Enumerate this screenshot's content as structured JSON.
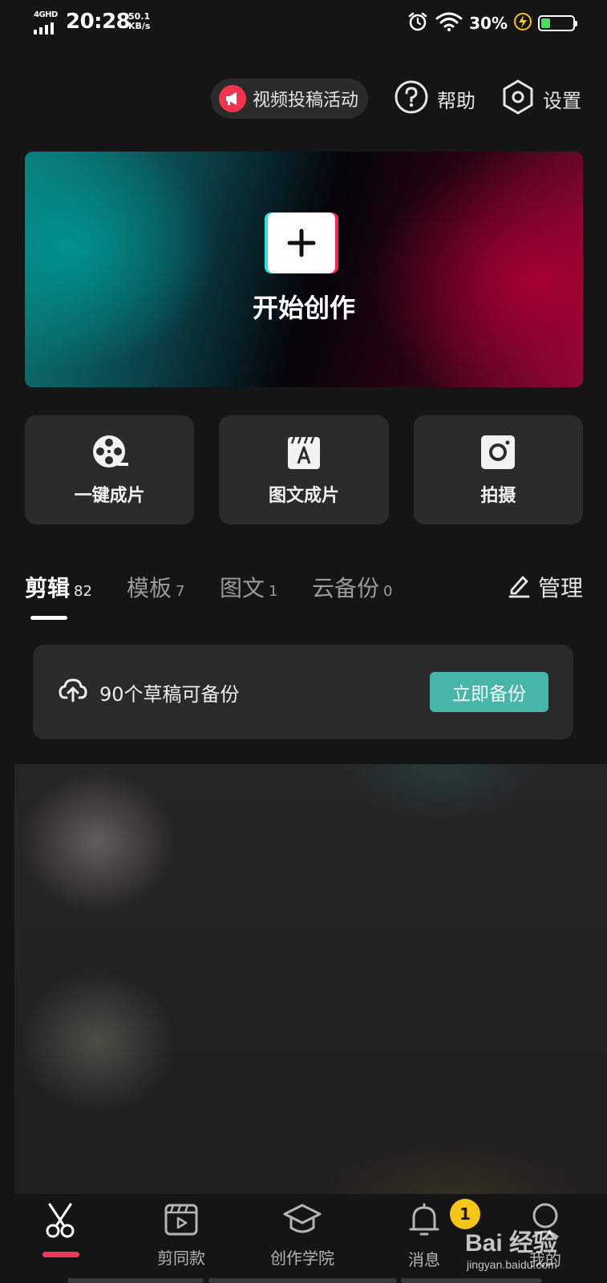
{
  "status_bar": {
    "network": "4GHD",
    "time": "20:28",
    "speed_value": "50.1",
    "speed_unit": "KB/s",
    "battery_percent": "30%",
    "battery_level": 0.3,
    "icons": [
      "alarm-icon",
      "wifi-icon",
      "charging-icon",
      "battery-icon"
    ]
  },
  "top_actions": {
    "promo_label": "视频投稿活动",
    "help_label": "帮助",
    "settings_label": "设置"
  },
  "hero": {
    "title": "开始创作"
  },
  "quick_actions": [
    {
      "label": "一键成片",
      "icon": "film-reel-icon"
    },
    {
      "label": "图文成片",
      "icon": "text-clapper-icon"
    },
    {
      "label": "拍摄",
      "icon": "camera-icon"
    }
  ],
  "tabs": [
    {
      "label": "剪辑",
      "count": "82"
    },
    {
      "label": "模板",
      "count": "7"
    },
    {
      "label": "图文",
      "count": "1"
    },
    {
      "label": "云备份",
      "count": "0"
    }
  ],
  "manage_label": "管理",
  "backup": {
    "message": "90个草稿可备份",
    "button": "立即备份"
  },
  "bottom_nav": [
    {
      "label": "",
      "icon": "scissors-icon"
    },
    {
      "label": "剪同款",
      "icon": "template-icon"
    },
    {
      "label": "创作学院",
      "icon": "graduation-cap-icon"
    },
    {
      "label": "消息",
      "icon": "bell-icon"
    },
    {
      "label": "我的",
      "icon": "profile-icon"
    }
  ],
  "messages_badge": "1",
  "watermark": {
    "line1": "Bai 经验",
    "line2": "jingyan.baidu.com"
  },
  "colors": {
    "accent_pink": "#f0375a",
    "backup_button": "#47b5a8",
    "badge": "#f5c51b",
    "battery_fill": "#4cd964"
  }
}
